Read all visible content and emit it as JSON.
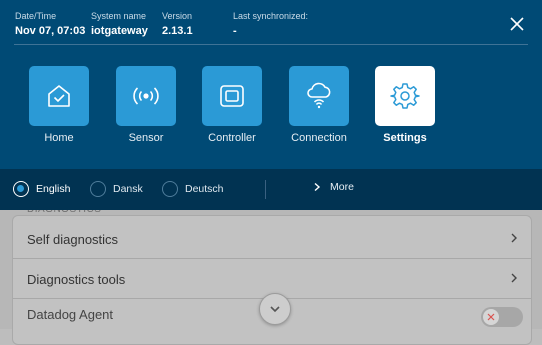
{
  "info": {
    "datetime_label": "Date/Time",
    "datetime_value": "Nov 07, 07:03",
    "system_label": "System name",
    "system_value": "iotgateway",
    "version_label": "Version",
    "version_value": "2.13.1",
    "sync_label": "Last synchronized:",
    "sync_value": "-"
  },
  "nav": {
    "tiles": [
      {
        "label": "Home",
        "icon": "home-icon"
      },
      {
        "label": "Sensor",
        "icon": "sensor-icon"
      },
      {
        "label": "Controller",
        "icon": "controller-icon"
      },
      {
        "label": "Connection",
        "icon": "cloud-connection-icon"
      },
      {
        "label": "Settings",
        "icon": "gear-icon",
        "active": true
      }
    ]
  },
  "languages": {
    "options": [
      {
        "label": "English",
        "selected": true
      },
      {
        "label": "Dansk",
        "selected": false
      },
      {
        "label": "Deutsch",
        "selected": false
      }
    ],
    "more_label": "More"
  },
  "background": {
    "section_label": "DIAGNOSTICS",
    "rows": [
      {
        "label": "Self diagnostics"
      },
      {
        "label": "Diagnostics tools"
      },
      {
        "label": "Datadog Agent"
      }
    ]
  },
  "colors": {
    "panel": "#004a75",
    "language_bar": "#013352",
    "tile": "#2b9ad6",
    "tile_active": "#ffffff"
  }
}
